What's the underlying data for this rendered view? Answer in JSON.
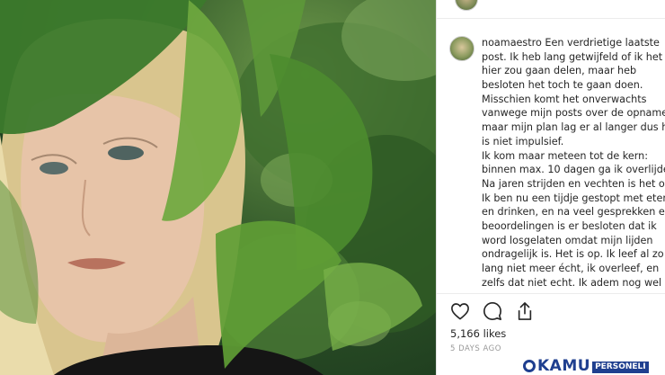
{
  "post": {
    "username": "noamaestro",
    "caption_lines": [
      "Een verdrietige laatste",
      "post. Ik heb lang getwijfeld of ik het",
      "hier zou gaan delen, maar heb",
      "besloten het toch te gaan doen.",
      "Misschien komt het onverwachts",
      "vanwege mijn posts over de opname",
      "maar mijn plan lag er al langer dus he",
      "is niet impulsief.",
      "Ik kom maar meteen tot de kern:",
      "binnen max. 10 dagen ga ik overlijde",
      "Na jaren strijden en vechten is het op",
      "Ik ben nu een tijdje gestopt met eten",
      "en drinken, en na veel gesprekken en",
      "beoordelingen is er besloten dat ik",
      "word losgelaten omdat mijn lijden",
      "ondragelijk is. Het is op. Ik leef al zo",
      "lang niet meer écht, ik overleef, en",
      "zelfs dat niet echt. Ik adem nog wel"
    ],
    "likes": "5,166 likes",
    "timestamp": "5 DAYS AGO"
  },
  "icons": {
    "like": "heart-icon",
    "comment": "comment-icon",
    "share": "share-icon"
  },
  "watermark": {
    "brand": "KAMU",
    "tag": "PERSONELI"
  },
  "colors": {
    "text": "#262626",
    "muted": "#999999",
    "watermark": "#1f3f8f"
  }
}
